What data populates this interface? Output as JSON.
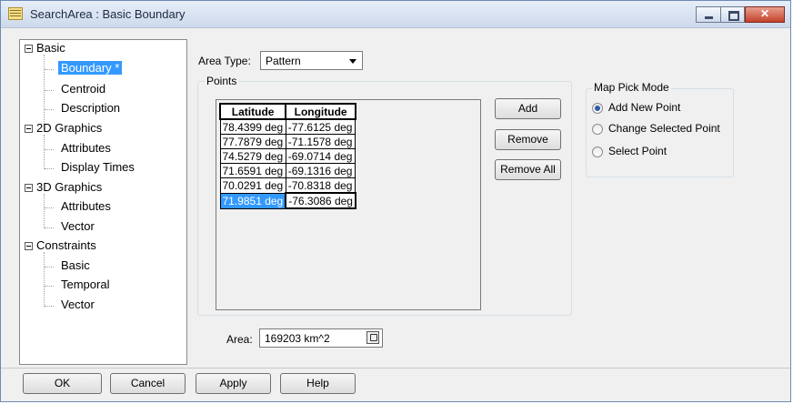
{
  "window": {
    "title": "SearchArea : Basic Boundary",
    "close_glyph": "✕"
  },
  "tree": {
    "basic": "Basic",
    "boundary": "Boundary *",
    "centroid": "Centroid",
    "description": "Description",
    "graphics2d": "2D Graphics",
    "attributes2d": "Attributes",
    "display_times": "Display Times",
    "graphics3d": "3D Graphics",
    "attributes3d": "Attributes",
    "vector3d": "Vector",
    "constraints": "Constraints",
    "c_basic": "Basic",
    "c_temporal": "Temporal",
    "c_vector": "Vector"
  },
  "area_type": {
    "label": "Area Type:",
    "value": "Pattern"
  },
  "points": {
    "title": "Points",
    "headers": {
      "lat": "Latitude",
      "lon": "Longitude"
    },
    "rows": [
      {
        "lat": "78.4399 deg",
        "lon": "-77.6125 deg"
      },
      {
        "lat": "77.7879 deg",
        "lon": "-71.1578 deg"
      },
      {
        "lat": "74.5279 deg",
        "lon": "-69.0714 deg"
      },
      {
        "lat": "71.6591 deg",
        "lon": "-69.1316 deg"
      },
      {
        "lat": "70.0291 deg",
        "lon": "-70.8318 deg"
      },
      {
        "lat": "71.9851 deg",
        "lon": "-76.3086 deg"
      }
    ],
    "add": "Add",
    "remove": "Remove",
    "remove_all": "Remove All"
  },
  "map_pick": {
    "title": "Map Pick Mode",
    "add_new": "Add New Point",
    "change_selected": "Change Selected Point",
    "select_point": "Select Point"
  },
  "area": {
    "label": "Area:",
    "value": "169203 km^2"
  },
  "footer": {
    "ok": "OK",
    "cancel": "Cancel",
    "apply": "Apply",
    "help": "Help"
  }
}
